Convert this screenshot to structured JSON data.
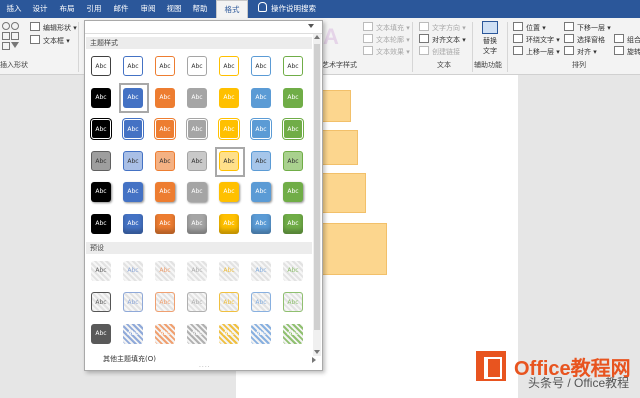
{
  "tabs": [
    {
      "label": "插入",
      "active": false
    },
    {
      "label": "设计",
      "active": false
    },
    {
      "label": "布局",
      "active": false
    },
    {
      "label": "引用",
      "active": false
    },
    {
      "label": "邮件",
      "active": false
    },
    {
      "label": "审阅",
      "active": false
    },
    {
      "label": "视图",
      "active": false
    },
    {
      "label": "帮助",
      "active": false
    },
    {
      "label": "格式",
      "active": true
    }
  ],
  "search": {
    "label": "操作说明搜索",
    "icon": "lightbulb-icon"
  },
  "ribbon": {
    "insert_shapes": {
      "edit_shape": "编辑形状",
      "text_box": "文本框",
      "group_label": "插入形状"
    },
    "wordart": {
      "group_label": "艺术字样式",
      "text_fill": "文本填充",
      "text_outline": "文本轮廓",
      "text_effects": "文本效果"
    },
    "text": {
      "group_label": "文本",
      "text_direction": "文字方向",
      "align_text": "对齐文本",
      "create_link": "创建链接"
    },
    "accessibility": {
      "group_label": "辅助功能",
      "alt_text_line1": "替换",
      "alt_text_line2": "文字"
    },
    "arrange": {
      "group_label": "排列",
      "position": "位置",
      "wrap_text": "环绕文字",
      "bring_forward": "上移一层",
      "send_backward": "下移一层",
      "selection_pane": "选择窗格",
      "align": "对齐",
      "group": "组合",
      "rotate": "旋转"
    }
  },
  "gallery": {
    "theme_section": "主题样式",
    "preset_section": "预设",
    "more_fills": "其他主题填充(O)",
    "swatch_text": "Abc",
    "theme_colors": [
      "#ffffff",
      "#4472c4",
      "#ed7d31",
      "#a5a5a5",
      "#ffc000",
      "#5b9bd5",
      "#70ad47"
    ],
    "theme_outline_colors": [
      "#404040",
      "#4472c4",
      "#ed7d31",
      "#a5a5a5",
      "#ffc000",
      "#5b9bd5",
      "#70ad47"
    ],
    "light_colors": [
      "#9e9e9e",
      "#a9bfe6",
      "#f4b183",
      "#c9c9c9",
      "#ffe08a",
      "#a6c6ea",
      "#a9d18e"
    ],
    "dark_fill": "#000000",
    "preset_text_colors": [
      "#666666",
      "#8fa9d9",
      "#f0a070",
      "#b0b0b0",
      "#f0c040",
      "#88b0e0",
      "#90c070"
    ],
    "preset_dark_fill": "#595959"
  },
  "logo": {
    "title": "Office教程网",
    "subtitle": "头条号 / Office教程"
  }
}
